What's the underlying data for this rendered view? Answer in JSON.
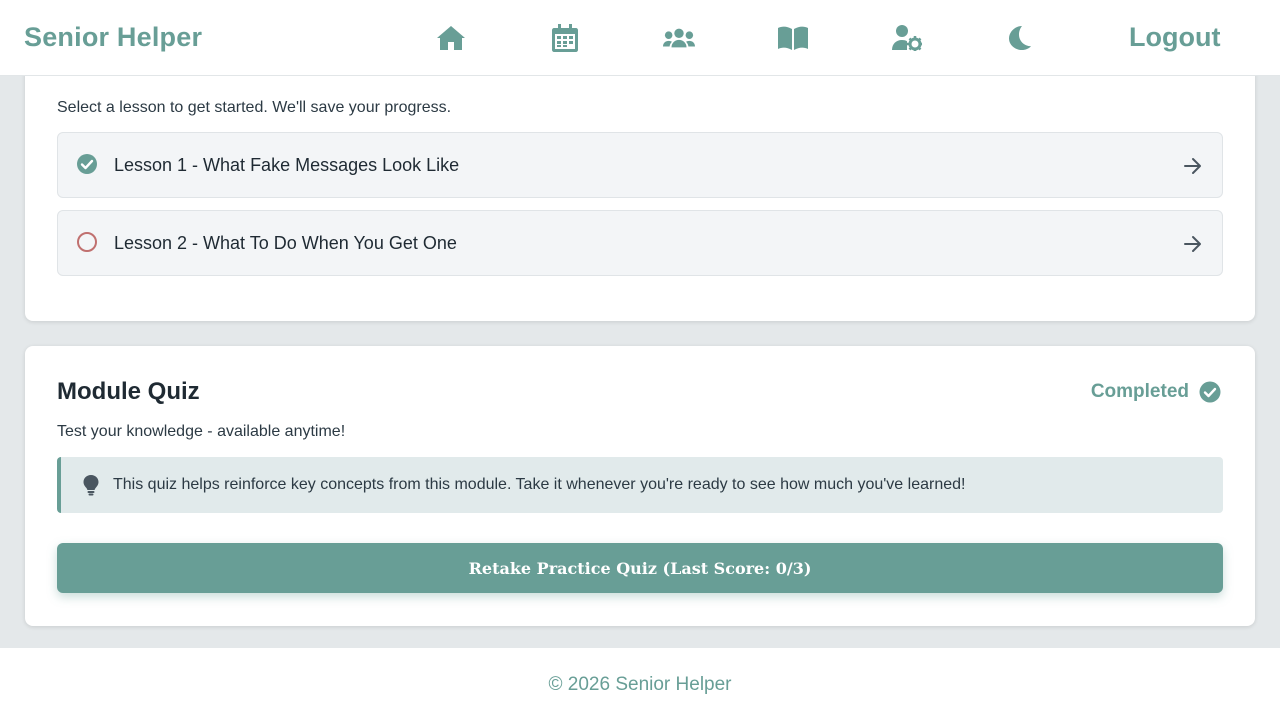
{
  "header": {
    "brand": "Senior Helper",
    "nav": [
      {
        "icon": "home-icon"
      },
      {
        "icon": "calendar-icon"
      },
      {
        "icon": "users-icon"
      },
      {
        "icon": "book-icon"
      },
      {
        "icon": "user-gear-icon"
      },
      {
        "icon": "moon-icon"
      }
    ],
    "logout_label": "Logout"
  },
  "lessons_card": {
    "intro": "Select a lesson to get started. We'll save your progress.",
    "lessons": [
      {
        "title": "Lesson 1 - What Fake Messages Look Like",
        "status": "completed",
        "status_icon": "check-circle-icon"
      },
      {
        "title": "Lesson 2 - What To Do When You Get One",
        "status": "not-started",
        "status_icon": "empty-circle-icon"
      }
    ]
  },
  "quiz_card": {
    "title": "Module Quiz",
    "status_label": "Completed",
    "subtitle": "Test your knowledge - available anytime!",
    "tip": "This quiz helps reinforce key concepts from this module. Take it whenever you're ready to see how much you've learned!",
    "retake_label": "Retake Practice Quiz (Last Score: 0/3)"
  },
  "footer": {
    "text": "© 2026 Senior Helper"
  },
  "colors": {
    "accent": "#689e96",
    "incomplete": "#c0706f",
    "background": "#e4e8ea",
    "tip_bg": "#e1eaeb"
  }
}
